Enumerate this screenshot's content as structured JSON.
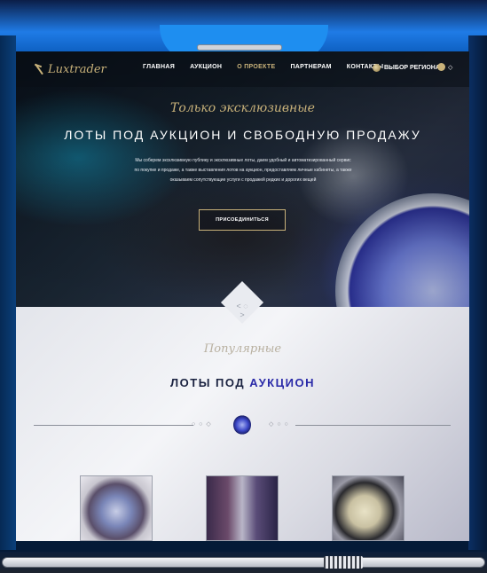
{
  "nav": {
    "logo_text": "Luxtrader",
    "items": [
      {
        "label": "ГЛАВНАЯ"
      },
      {
        "label": "АУКЦИОН"
      },
      {
        "label": "О ПРОЕКТЕ"
      },
      {
        "label": "ПАРТНЕРАМ"
      },
      {
        "label": "КОНТАКТЫ"
      }
    ],
    "region_label": "ВЫБОР РЕГИОНА",
    "lang_arrow": "◇"
  },
  "hero": {
    "script_title": "Только эксклюзивные",
    "title": "ЛОТЫ ПОД АУКЦИОН И СВОБОДНУЮ ПРОДАЖУ",
    "text_line1": "Мы соберем эксклюзивную публику и эксклюзивные лоты, даем удобный и автоматизированный сервис",
    "text_line2": "по покупке и продаже, а также выставления лотов на аукцион, предоставляем личные кабинеты, а также",
    "text_line3": "оказываем сопутствующие услуги с продажей редких и дорогих вещей",
    "join_button": "ПРИСОЕДИНИТЬСЯ"
  },
  "lots": {
    "script_title": "Популярные",
    "title_main": "ЛОТЫ ПОД",
    "title_accent": "АУКЦИОН",
    "dots_left": "○ ○ ◇",
    "dots_right": "◇ ○ ○"
  },
  "colors": {
    "gold": "#c9b27a",
    "frame_blue": "#1e8ef0",
    "title_accent": "#2a2aa8"
  }
}
